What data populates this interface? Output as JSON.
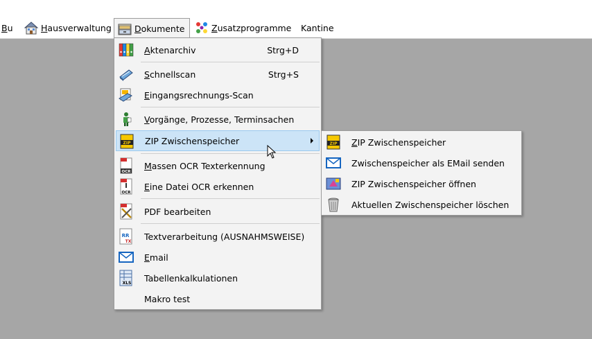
{
  "menubar": {
    "items": [
      {
        "label": "Bu"
      },
      {
        "label": "Hausverwaltung",
        "icon": "house-icon"
      },
      {
        "label": "Dokumente",
        "icon": "drawer-icon"
      },
      {
        "label": "Zusatzprogramme",
        "icon": "puzzle-icon"
      },
      {
        "label": "Kantine"
      }
    ]
  },
  "dokumente_menu": {
    "items": [
      {
        "label": "Aktenarchiv",
        "shortcut": "Strg+D",
        "icon": "binders-icon"
      },
      {
        "label": "Schnellscan",
        "shortcut": "Strg+S",
        "icon": "scanner-icon"
      },
      {
        "label": "Eingangsrechnungs-Scan",
        "icon": "invoice-scan-icon"
      },
      {
        "label": "Vorgänge, Prozesse, Terminsachen",
        "icon": "person-process-icon"
      },
      {
        "label": "ZIP Zwischenspeicher",
        "icon": "zip-icon"
      },
      {
        "label": "Massen OCR Texterkennung",
        "icon": "pdf-ocr-icon"
      },
      {
        "label": "Eine Datei OCR erkennen",
        "icon": "pdf-ocr-single-icon"
      },
      {
        "label": "PDF bearbeiten",
        "icon": "pdf-edit-icon"
      },
      {
        "label": "Textverarbeitung (AUSNAHMSWEISE)",
        "icon": "rtf-icon"
      },
      {
        "label": "Email",
        "icon": "email-icon"
      },
      {
        "label": "Tabellenkalkulationen",
        "icon": "xls-icon"
      },
      {
        "label": "Makro test"
      }
    ]
  },
  "zip_submenu": {
    "items": [
      {
        "label": "ZIP Zwischenspeicher",
        "icon": "zip-icon"
      },
      {
        "label": "Zwischenspeicher als EMail senden",
        "icon": "email-icon"
      },
      {
        "label": "ZIP Zwischenspeicher öffnen",
        "icon": "zip-open-icon"
      },
      {
        "label": "Aktuellen Zwischenspeicher löschen",
        "icon": "trash-icon"
      }
    ]
  },
  "colors": {
    "highlight": "#cce4f7",
    "highlight_border": "#99c9ef",
    "menu_bg": "#f3f3f3",
    "desktop_bg": "#a6a6a6"
  }
}
